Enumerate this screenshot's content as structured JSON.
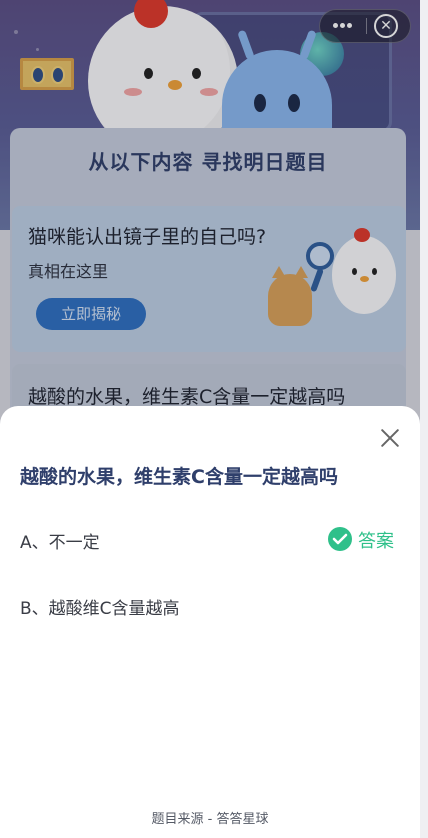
{
  "background": {
    "board_title": "从以下内容 寻找明日题目",
    "promo": {
      "question": "猫咪能认出镜子里的自己吗?",
      "subtitle": "真相在这里",
      "button_label": "立即揭秘"
    },
    "previous_question": "越酸的水果，维生素C含量一定越高吗"
  },
  "capsule": {
    "more_icon": "more-dots-icon",
    "close_icon": "close-circle-icon",
    "close_glyph": "✕"
  },
  "sheet": {
    "question": "越酸的水果，维生素C含量一定越高吗",
    "options": [
      {
        "label": "A、不一定",
        "is_answer": true
      },
      {
        "label": "B、越酸维C含量越高",
        "is_answer": false
      }
    ],
    "answer_label": "答案",
    "footer": "题目来源 - 答答星球"
  },
  "colors": {
    "accent_green": "#2fc08a",
    "question_blue": "#2f3f6b",
    "button_blue": "#2e6fc3"
  }
}
